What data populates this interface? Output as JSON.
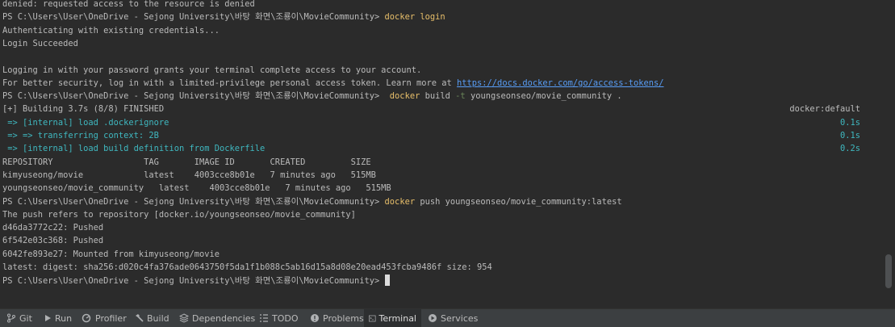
{
  "terminal": {
    "prompt": "PS C:\\Users\\User\\OneDrive - Sejong University\\바탕 화면\\조룡이\\MovieCommunity>",
    "lines": {
      "l0": "denied: requested access to the resource is denied",
      "l1_cmd": "docker login",
      "l2": "Authenticating with existing credentials...",
      "l3": "Login Succeeded",
      "l5": "Logging in with your password grants your terminal complete access to your account.",
      "l6_text": "For better security, log in with a limited-privilege personal access token. Learn more at ",
      "l6_link": "https://docs.docker.com/go/access-tokens/",
      "l7_cmd": "docker",
      "l7_sub": "build",
      "l7_flag": "-t",
      "l7_args": "youngseonseo/movie_community .",
      "l8": "[+] Building 3.7s (8/8) FINISHED",
      "l8_right": "docker:default",
      "l9": " => [internal] load .dockerignore",
      "l9_right": "0.1s",
      "l10": " => => transferring context: 2B",
      "l10_right": "0.1s",
      "l11": " => [internal] load build definition from Dockerfile",
      "l11_right": "0.2s",
      "l12": "REPOSITORY                  TAG       IMAGE ID       CREATED         SIZE",
      "l13": "kimyuseong/movie            latest    4003cce8b01e   7 minutes ago   515MB",
      "l14": "youngseonseo/movie_community   latest    4003cce8b01e   7 minutes ago   515MB",
      "l15_cmd": "docker",
      "l15_args": "push youngseonseo/movie_community:latest",
      "l16": "The push refers to repository [docker.io/youngseonseo/movie_community]",
      "l17": "d46da3772c22: Pushed",
      "l18": "6f542e03c368: Pushed",
      "l19": "6042fe893e27: Mounted from kimyuseong/movie",
      "l20": "latest: digest: sha256:d020c4fa376ade0643750f5da1f1b088c5ab16d15a8d08e20ead453fcba9486f size: 954"
    }
  },
  "toolbar": {
    "git": "Git",
    "run": "Run",
    "profiler": "Profiler",
    "build": "Build",
    "dependencies": "Dependencies",
    "todo": "TODO",
    "problems": "Problems",
    "terminal": "Terminal",
    "services": "Services"
  },
  "colors": {
    "background": "#2b2b2b",
    "text": "#bbbbbb",
    "command": "#e8bf6a",
    "link": "#589df6",
    "build_step": "#3fb8c0"
  }
}
